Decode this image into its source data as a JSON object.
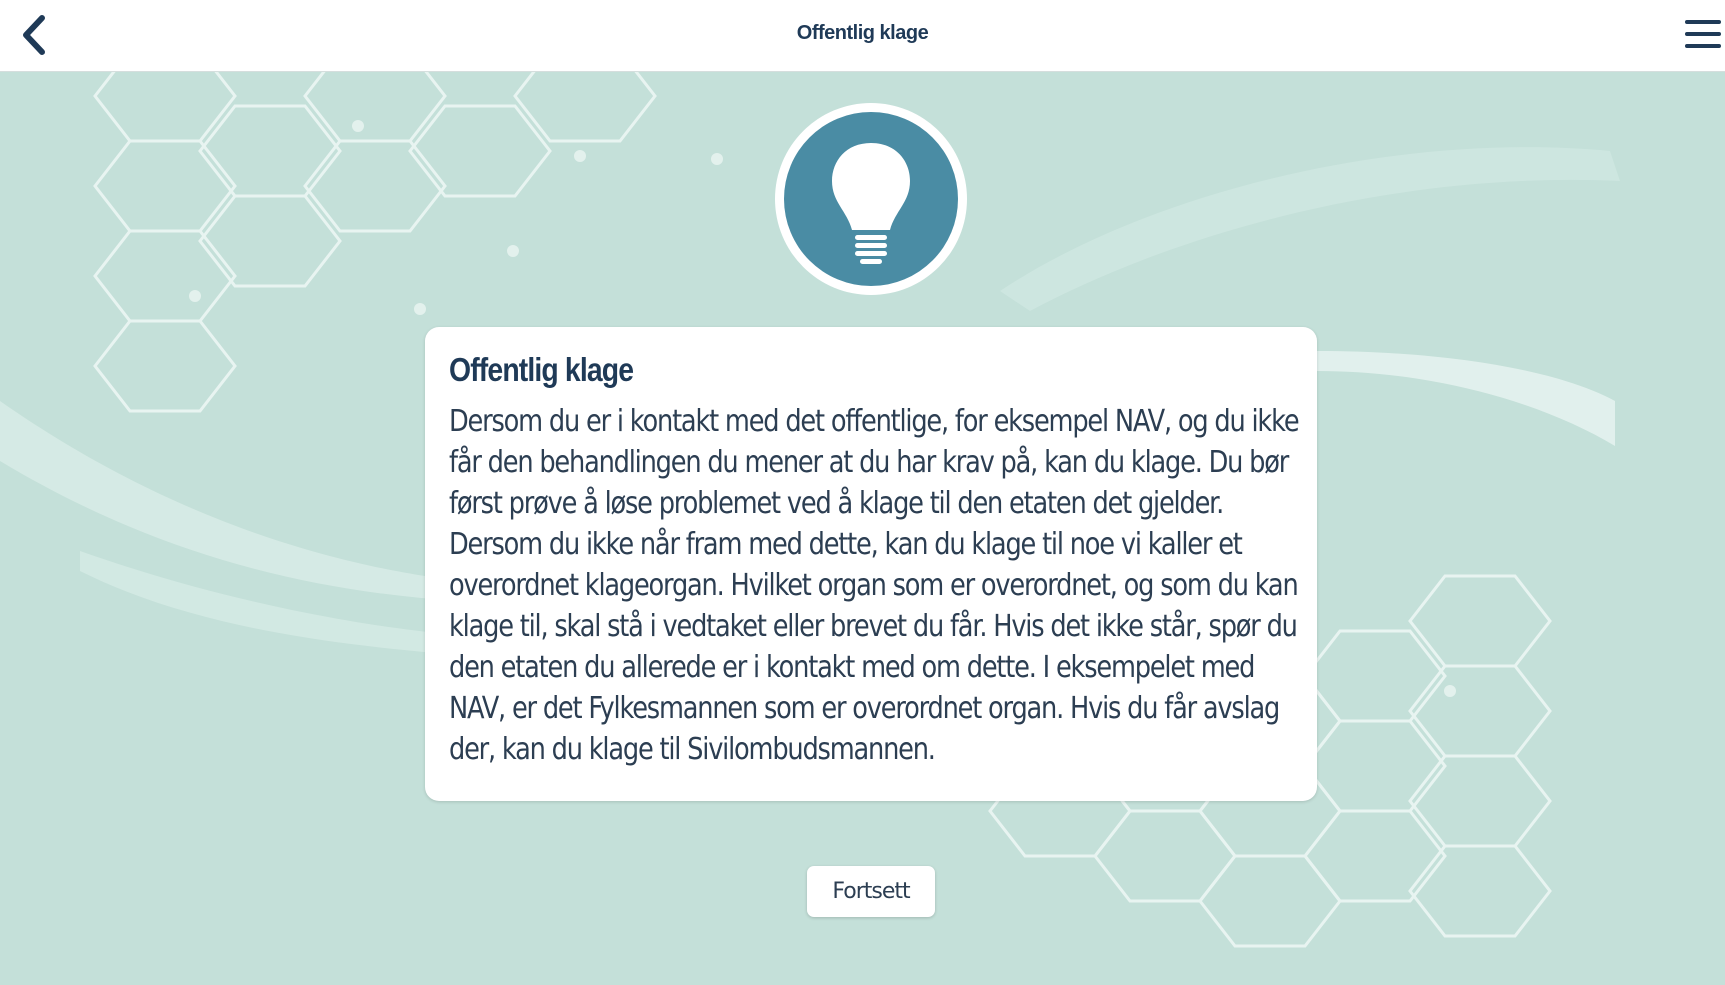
{
  "header": {
    "title": "Offentlig klage",
    "back_icon": "chevron-left-icon",
    "menu_icon": "hamburger-menu-icon"
  },
  "hero_icon": "lightbulb-icon",
  "card": {
    "title": "Offentlig klage",
    "body": "Dersom du er i kontakt med det offentlige, for eksempel NAV, og du ikke får den behandlingen du mener at du har krav på, kan du klage. Du bør først prøve å løse problemet ved å klage til den etaten det gjelder. Dersom du ikke når fram med dette, kan du klage til noe vi kaller et overordnet klageorgan. Hvilket organ som er overordnet, og som du kan klage til, skal stå i vedtaket eller brevet du får. Hvis det ikke står, spør du den etaten du allerede er i kontakt med om dette. I eksempelet med NAV, er det Fylkesmannen som er overordnet organ. Hvis du får avslag der, kan du klage til Sivilombudsmannen."
  },
  "actions": {
    "continue_label": "Fortsett"
  },
  "colors": {
    "background": "#c4e0d9",
    "accent": "#4a8ca4",
    "text_dark": "#1f3a57"
  }
}
